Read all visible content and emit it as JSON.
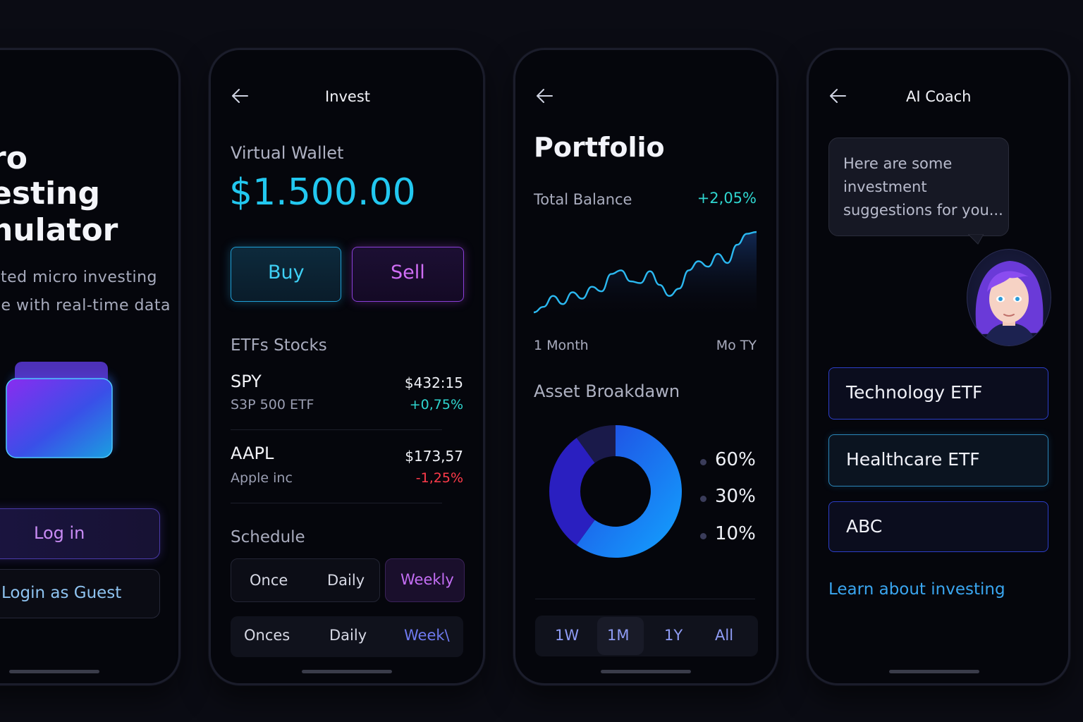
{
  "colors": {
    "background": "#0b0c14",
    "accent_cyan": "#22c8f0",
    "accent_purple": "#c05cf0",
    "positive": "#2fd6d0",
    "negative": "#ff3b4a",
    "link": "#3aa6f0"
  },
  "welcome": {
    "title_line1": "ro",
    "title_line2": "esting",
    "title_line3": "nulator",
    "subtitle_line1": "ated micro investing",
    "subtitle_line2": "ne with real-time data",
    "login_label": "Log in",
    "guest_label": "Login as Guest",
    "wallet_icon": "wallet-icon"
  },
  "invest": {
    "header_title": "Invest",
    "wallet_label": "Virtual Wallet",
    "wallet_balance": "$1.500.00",
    "buy_label": "Buy",
    "sell_label": "Sell",
    "section_label": "ETFs Stocks",
    "stocks": [
      {
        "ticker": "SPY",
        "name": "S3P 500 ETF",
        "price": "$432:15",
        "change": "+0,75%"
      },
      {
        "ticker": "AAPL",
        "name": "Apple inc",
        "price": "$173,57",
        "change": "-1,25%"
      }
    ],
    "schedule_label": "Schedule",
    "schedule_row1": [
      "Once",
      "Daily",
      "Weekly"
    ],
    "schedule_row2": [
      "Onces",
      "Daily",
      "Week\\"
    ]
  },
  "portfolio": {
    "title": "Portfolio",
    "total_label": "Total Balance",
    "total_change": "+2,05%",
    "chart_start_label": "1 Month",
    "chart_end_label": "Mo TY",
    "breakdown_label": "Asset Broakdawn",
    "allocations": [
      "60%",
      "30%",
      "10%"
    ],
    "ranges": [
      "1W",
      "1M",
      "1Y",
      "All"
    ],
    "active_range": "1M"
  },
  "coach": {
    "header_title": "AI Coach",
    "bubble_text": "Here are some investment suggestions for you...",
    "options": [
      "Technology ETF",
      "Healthcare ETF",
      "ABC"
    ],
    "learn_link": "Learn about investing"
  },
  "chart_data": [
    {
      "type": "line",
      "x_start_label": "1 Month",
      "x_end_label": "Mo TY",
      "values": [
        0,
        0.6,
        1.8,
        0.9,
        2.2,
        1.5,
        2.8,
        2.3,
        4.2,
        4.6,
        3.4,
        3.2,
        4.5,
        3.0,
        1.8,
        2.6,
        4.6,
        5.6,
        5.0,
        6.4,
        5.4,
        7.4,
        8.6,
        8.8
      ],
      "title": "",
      "xlabel": "",
      "ylabel": ""
    },
    {
      "type": "pie",
      "labels": [
        "60%",
        "30%",
        "10%"
      ],
      "values": [
        60,
        30,
        10
      ],
      "title": ""
    }
  ]
}
